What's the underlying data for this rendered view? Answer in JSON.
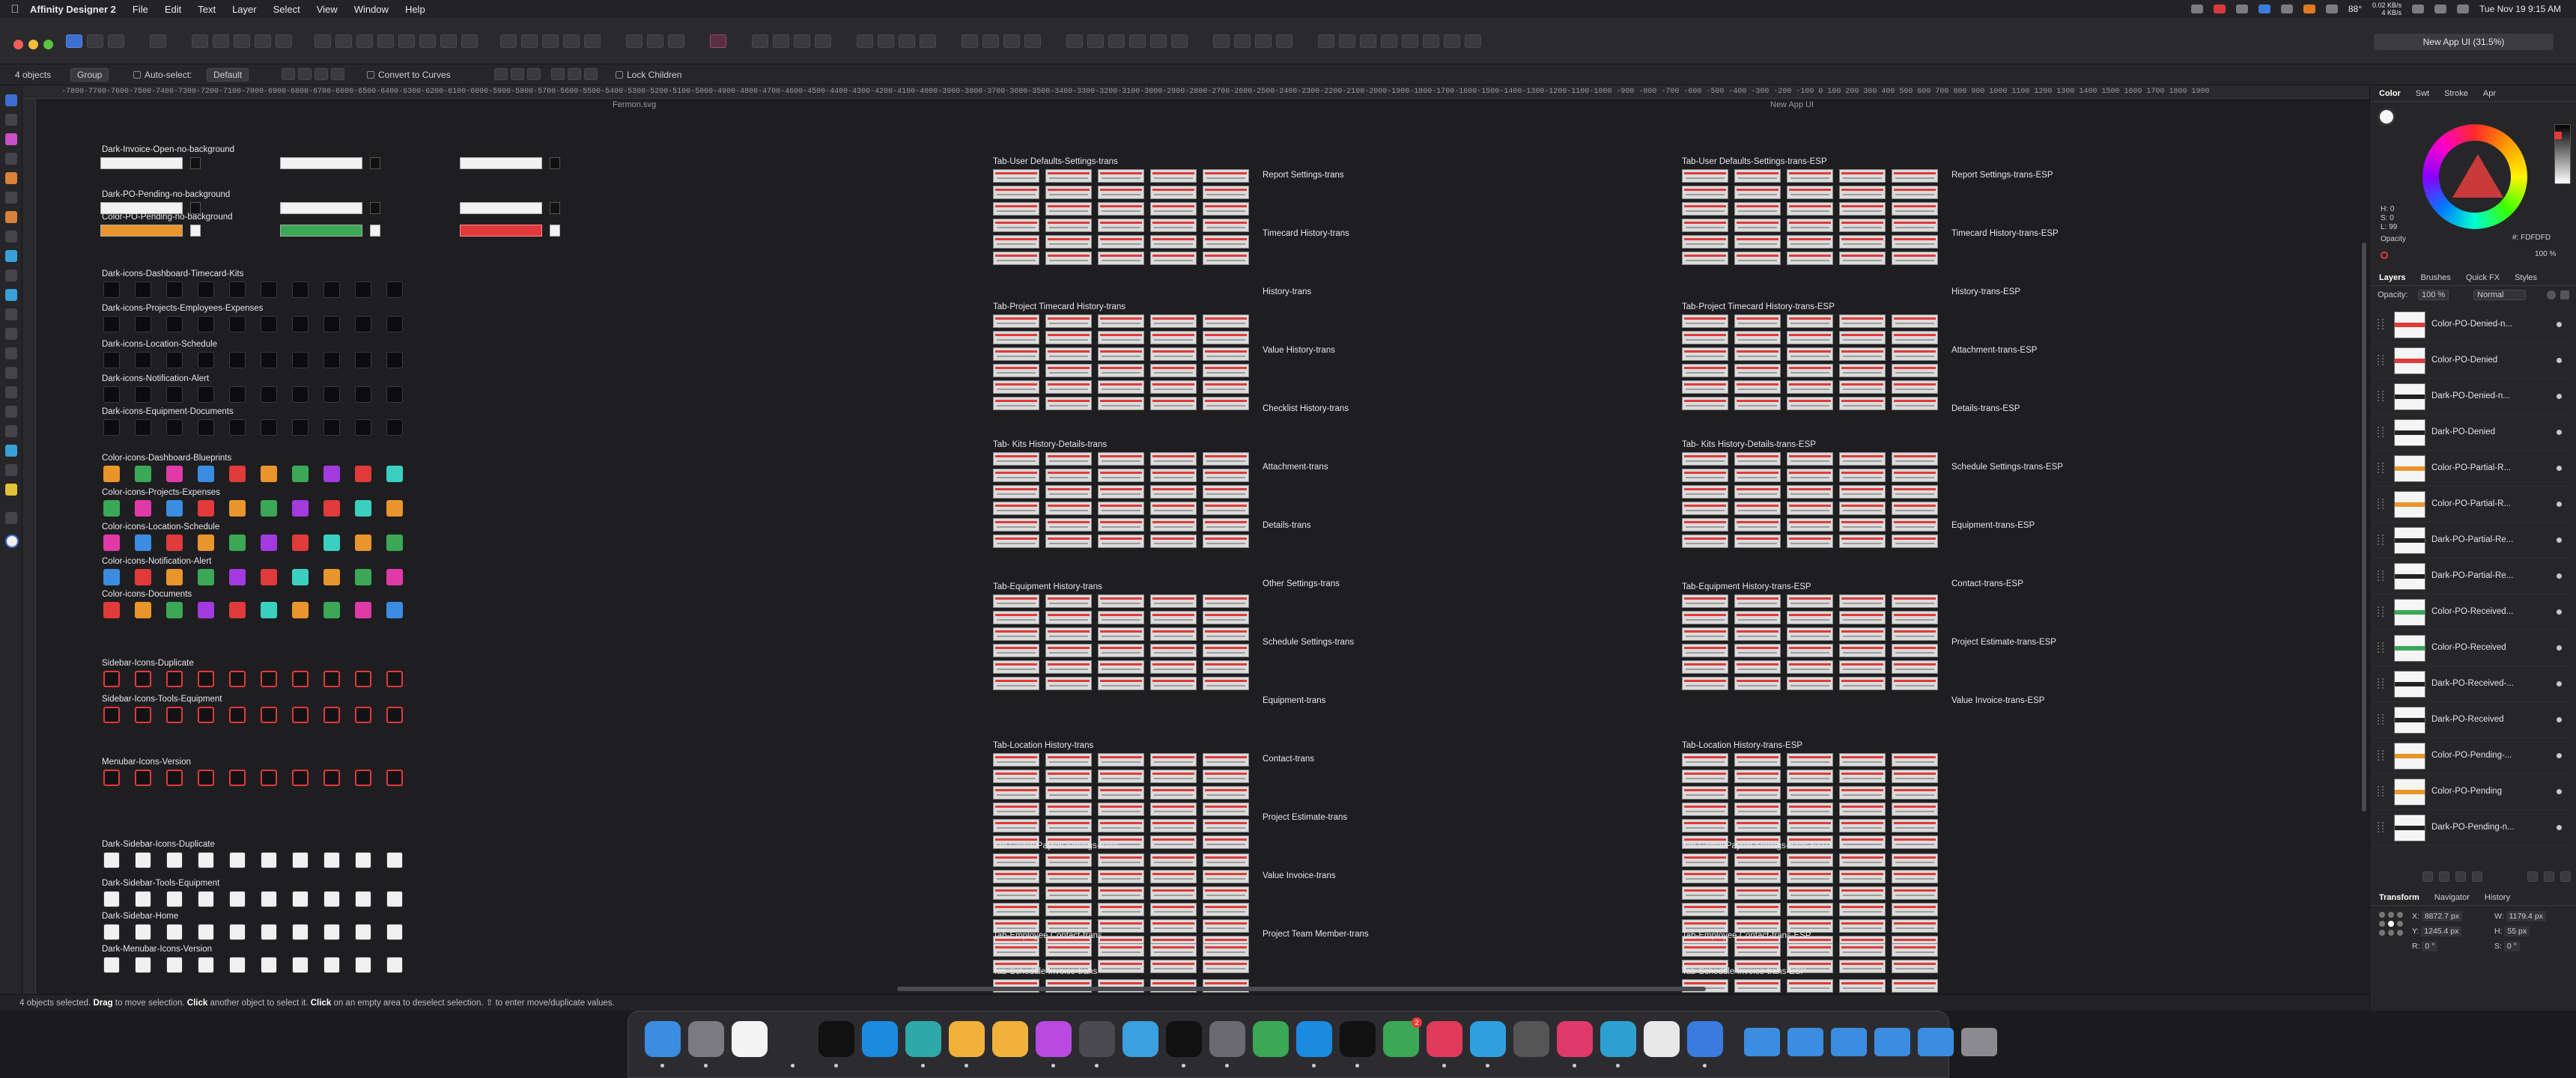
{
  "menubar": {
    "app_name": "Affinity Designer 2",
    "menus": [
      "File",
      "Edit",
      "Text",
      "Layer",
      "Select",
      "View",
      "Window",
      "Help"
    ],
    "clock": "Tue Nov 19  9:15 AM",
    "net_up": "0.02 KB/s",
    "net_down": "4 KB/s",
    "brightness": "88°"
  },
  "window": {
    "document_chip": "New App UI (31.5%)",
    "doc_label": "New App UI",
    "secondary_file": "Fermon.svg"
  },
  "context_bar": {
    "selection_count": "4 objects",
    "group_button": "Group",
    "auto_select_label": "Auto-select:",
    "auto_select_value": "Default",
    "convert_button": "Convert to Curves",
    "lock_children": "Lock Children"
  },
  "ruler": {
    "ticks": "-7800-7700-7600-7500-7400-7300-7200-7100-7000-6900-6800-6700-6600-6500-6400-6300-6200-6100-6000-5900-5800-5700-5600-5500-5400-5300-5200-5100-5000-4900-4800-4700-4600-4500-4400-4300-4200-4100-4000-3900-3800-3700-3600-3500-3400-3300-3200-3100-3000-2900-2800-2700-2600-2500-2400-2300-2200-2100-2000-1900-1800-1700-1600-1500-1400-1300-1200-1100-1000 -900 -800 -700 -600 -500 -400 -300 -200 -100 0 100 200 300 400 500 600 700 800 900 1000 1100 1200 1300 1400 1500 1600 1700 1800 1900"
  },
  "canvas": {
    "left_column_labels": [
      "Dark-Invoice-Open-no-background",
      "Dark-PO-Pending-no-background",
      "Color-PO-Pending-no-background",
      "Dark-icons-Dashboard-Timecard-Kits",
      "Dark-icons-Projects-Employees-Expenses",
      "Dark-icons-Location-Schedule",
      "Dark-icons-Notification-Alert",
      "Dark-icons-Equipment-Documents",
      "Color-icons-Dashboard-Blueprints",
      "Color-icons-Projects-Expenses",
      "Color-icons-Location-Schedule",
      "Color-icons-Notification-Alert",
      "Color-icons-Documents",
      "Sidebar-Icons-Duplicate",
      "Sidebar-Icons-Tools-Equipment",
      "Menubar-Icons-Version",
      "Dark-Sidebar-Icons-Duplicate",
      "Dark-Sidebar-Tools-Equipment",
      "Dark-Sidebar-Home",
      "Dark-Menubar-Icons-Version"
    ],
    "mid_column_labels": [
      "Tab-User Defaults-Settings-trans",
      "Tab-Project Timecard History-trans",
      "Tab- Kits History-Details-trans",
      "Tab-Equipment History-trans",
      "Tab-Location History-trans",
      "Tab-Global Payroll Settings-trans",
      "Tab-Employee Contact-trans",
      "Tab-Schedule Invoice-trans"
    ],
    "mid_side_labels": [
      "Report Settings-trans",
      "Timecard History-trans",
      "History-trans",
      "Value History-trans",
      "Checklist History-trans",
      "Attachment-trans",
      "Details-trans",
      "Other Settings-trans",
      "Schedule Settings-trans",
      "Equipment-trans",
      "Contact-trans",
      "Project Estimate-trans",
      "Value Invoice-trans",
      "Project Team Member-trans"
    ],
    "right_column_labels": [
      "Tab-User Defaults-Settings-trans-ESP",
      "Tab-Project Timecard History-trans-ESP",
      "Tab- Kits History-Details-trans-ESP",
      "Tab-Equipment History-trans-ESP",
      "Tab-Location History-trans-ESP",
      "Tab-Global Payroll Settings-trans-ESP",
      "Tab-Employee Contact-trans-ESP",
      "Tab-Schedule Invoice-trans-ESP"
    ],
    "right_side_labels": [
      "Report Settings-trans-ESP",
      "Timecard History-trans-ESP",
      "History-trans-ESP",
      "Attachment-trans-ESP",
      "Details-trans-ESP",
      "Schedule Settings-trans-ESP",
      "Equipment-trans-ESP",
      "Contact-trans-ESP",
      "Project Estimate-trans-ESP",
      "Value Invoice-trans-ESP"
    ]
  },
  "right_panel": {
    "top_tabs": [
      "Color",
      "Swt",
      "Stroke",
      "Apr"
    ],
    "hsl": {
      "h": "H: 0",
      "s": "S: 0",
      "l": "L: 99"
    },
    "hex": "#: FDFDFD",
    "opacity_label": "Opacity",
    "opacity_value": "100 %",
    "layer_tabs": [
      "Layers",
      "Brushes",
      "Quick FX",
      "Styles"
    ],
    "layer_opacity_label": "Opacity:",
    "layer_opacity_value": "100 %",
    "blend_mode": "Normal",
    "layers": [
      {
        "name": "Color-PO-Denied-n...",
        "color": "#e03a3a"
      },
      {
        "name": "Color-PO-Denied",
        "color": "#e03a3a"
      },
      {
        "name": "Dark-PO-Denied-n...",
        "color": "#222222"
      },
      {
        "name": "Dark-PO-Denied",
        "color": "#222222"
      },
      {
        "name": "Color-PO-Partial-R...",
        "color": "#e8952c"
      },
      {
        "name": "Color-PO-Partial-R...",
        "color": "#e8952c"
      },
      {
        "name": "Dark-PO-Partial-Re...",
        "color": "#222222"
      },
      {
        "name": "Dark-PO-Partial-Re...",
        "color": "#222222"
      },
      {
        "name": "Color-PO-Received...",
        "color": "#3aa856"
      },
      {
        "name": "Color-PO-Received",
        "color": "#3aa856"
      },
      {
        "name": "Dark-PO-Received-...",
        "color": "#222222"
      },
      {
        "name": "Dark-PO-Received",
        "color": "#222222"
      },
      {
        "name": "Color-PO-Pending-...",
        "color": "#e8952c"
      },
      {
        "name": "Color-PO-Pending",
        "color": "#e8952c"
      },
      {
        "name": "Dark-PO-Pending-n...",
        "color": "#222222"
      }
    ],
    "bottom_tabs": [
      "Transform",
      "Navigator",
      "History"
    ],
    "transform": {
      "x": "8872.7 px",
      "y": "1245.4 px",
      "w": "1179.4 px",
      "h": "55 px",
      "r": "0 °",
      "s": "0 °"
    }
  },
  "status_bar": {
    "count_text": "4 objects selected.",
    "drag_word": "Drag",
    "drag_text": "to move selection.",
    "click_word": "Click",
    "click_text": "another object to select it.",
    "click2_word": "Click",
    "click2_text": "on an empty area to deselect selection.",
    "tail_text": "⇧ to enter move/duplicate values."
  },
  "dock": {
    "message_badge": "2",
    "apps": [
      "Finder",
      "Launchpad",
      "Pen",
      "Rocket",
      "Notion",
      "Edge",
      "Affinity",
      "Sketch",
      "Studio",
      "Arc",
      "Grid",
      "Figma",
      "Capcut",
      "Settings",
      "Mail",
      "Safari",
      "Terminal",
      "Messages",
      "Music",
      "Xcode",
      "Stack",
      "Screenshot",
      "Perplexity",
      "XP-Pen",
      "Designer"
    ],
    "folders": [
      "Folder",
      "Folder",
      "Folder",
      "Downloads",
      "Home",
      "Trash"
    ]
  }
}
